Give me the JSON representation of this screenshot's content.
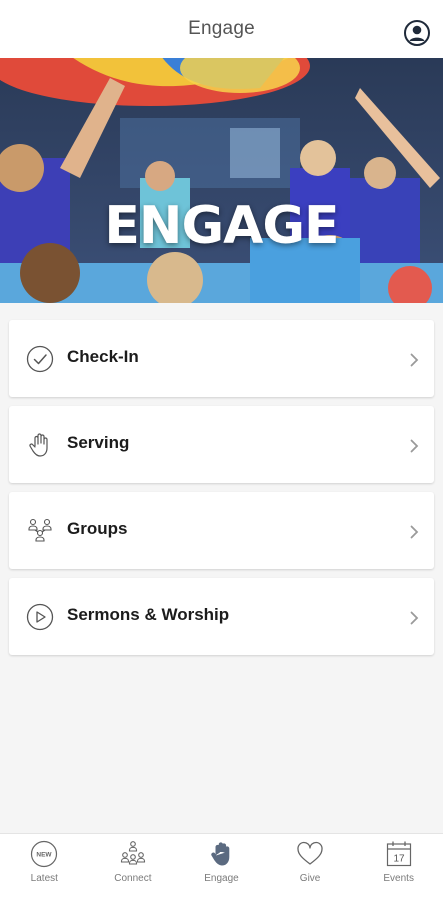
{
  "header": {
    "title": "Engage",
    "profile_icon": "profile-icon"
  },
  "hero": {
    "title": "ENGAGE"
  },
  "menu": [
    {
      "label": "Check-In",
      "icon": "check-circle-icon"
    },
    {
      "label": "Serving",
      "icon": "raised-hand-icon"
    },
    {
      "label": "Groups",
      "icon": "group-people-icon"
    },
    {
      "label": "Sermons & Worship",
      "icon": "play-circle-icon"
    }
  ],
  "tabs": [
    {
      "label": "Latest",
      "icon": "new-badge-icon",
      "badge_text": "NEW"
    },
    {
      "label": "Connect",
      "icon": "connect-people-icon"
    },
    {
      "label": "Engage",
      "icon": "raised-hand-icon",
      "active": true
    },
    {
      "label": "Give",
      "icon": "heart-icon"
    },
    {
      "label": "Events",
      "icon": "calendar-icon",
      "calendar_day": "17"
    }
  ],
  "colors": {
    "background": "#f5f5f5",
    "active_tab_icon": "#5b6a80",
    "icon_stroke": "#555555"
  }
}
